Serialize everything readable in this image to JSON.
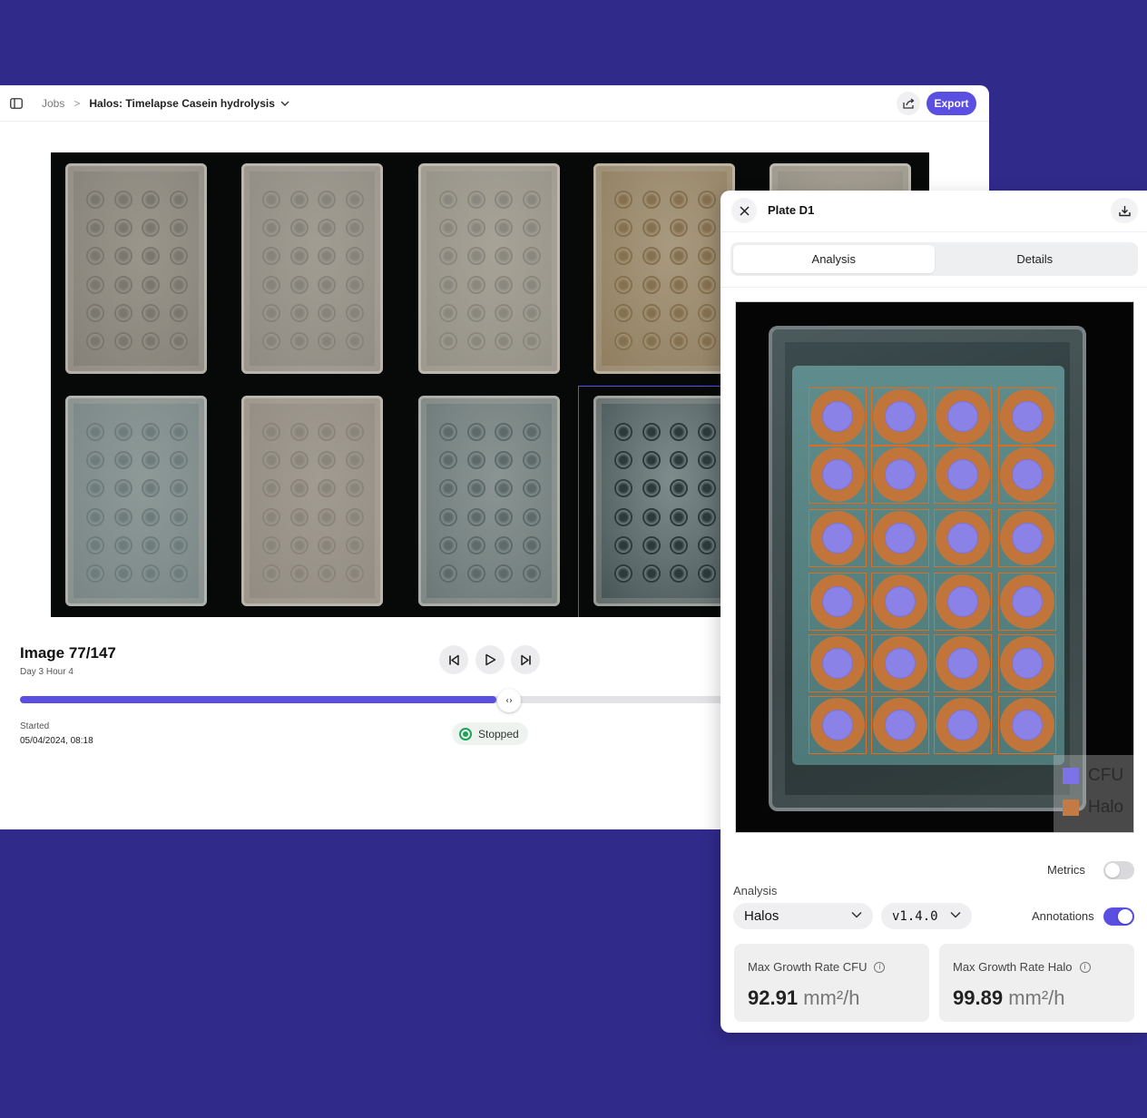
{
  "header": {
    "breadcrumb_root": "Jobs",
    "breadcrumb_separator": ">",
    "job_title": "Halos: Timelapse Casein hydrolysis",
    "export_label": "Export"
  },
  "viewer": {
    "image_label": "Image 77/147",
    "time_label": "Day 3 Hour 4",
    "progress_fraction": 0.525,
    "started_label": "Started",
    "started_value": "05/04/2024, 08:18",
    "status": "Stopped",
    "status_color": "#1fa35a",
    "knob_symbol": "‹›"
  },
  "panel": {
    "title": "Plate D1",
    "tabs": [
      {
        "label": "Analysis",
        "active": true
      },
      {
        "label": "Details",
        "active": false
      }
    ],
    "legend": [
      {
        "label": "CFU",
        "color": "#7b73e6"
      },
      {
        "label": "Halo",
        "color": "#c47a45"
      }
    ],
    "metrics_label": "Metrics",
    "metrics_on": false,
    "analysis_label": "Analysis",
    "analysis_value": "Halos",
    "version_value": "v1.4.0",
    "annotations_label": "Annotations",
    "annotations_on": true,
    "cards": [
      {
        "label": "Max Growth Rate CFU",
        "value": "92.91",
        "unit": "mm²/h"
      },
      {
        "label": "Max Growth Rate Halo",
        "value": "99.89",
        "unit": "mm²/h"
      }
    ]
  },
  "colors": {
    "background": "#302a8a",
    "accent": "#5a4fe0"
  }
}
